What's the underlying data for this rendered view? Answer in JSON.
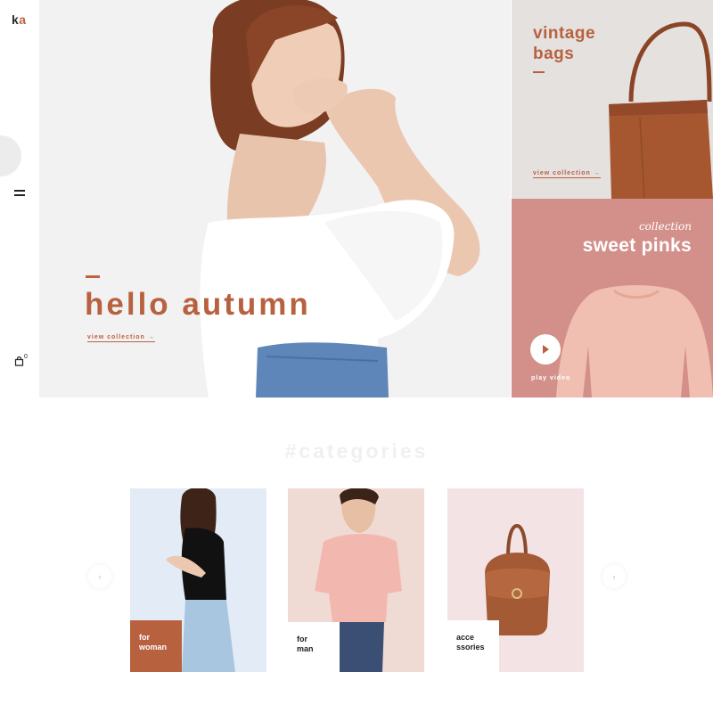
{
  "brand": {
    "logo_k": "k",
    "logo_a": "a"
  },
  "rail": {
    "cart_count": "0",
    "icons": [
      "menu-icon",
      "shopping-bag-icon"
    ]
  },
  "hero": {
    "title": "hello autumn",
    "link": "view collection →"
  },
  "promo_bags": {
    "title_line1": "vintage",
    "title_line2": "bags",
    "link": "view collection →"
  },
  "promo_pinks": {
    "overline": "collection",
    "title": "sweet pinks",
    "play_label": "play video",
    "icon": "play-icon"
  },
  "categories": {
    "heading": "#categories",
    "prev": "‹",
    "next": "›",
    "items": [
      {
        "line1": "for",
        "line2": "woman"
      },
      {
        "line1": "for",
        "line2": "man"
      },
      {
        "line1": "acce",
        "line2": "ssories"
      }
    ]
  },
  "colors": {
    "accent": "#b8613f",
    "pink_card": "#d3908a",
    "bags_card": "#e4e1df",
    "heading_ghost": "#f0f0f0"
  }
}
